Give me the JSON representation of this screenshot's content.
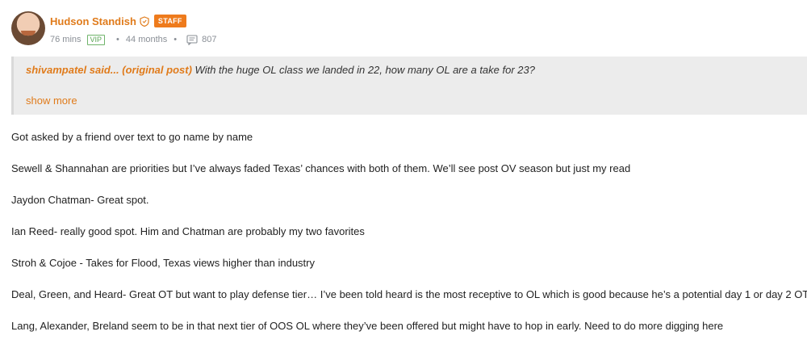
{
  "author": {
    "name": "Hudson Standish",
    "badge": "STAFF",
    "time_online": "76 mins",
    "vip_label": "VIP",
    "tenure": "44 months",
    "post_count": "807",
    "icons": {
      "shield": "shield-icon",
      "comments": "comment-icon"
    }
  },
  "quote": {
    "author": "shivampatel said...",
    "link_label": "original post",
    "text": "With the huge OL class we landed in 22, how many OL are a take for 23?",
    "show_more": "show more"
  },
  "post": {
    "paragraphs": [
      "Got asked by a friend over text to go name by name",
      "Sewell & Shannahan are priorities but I’ve always faded Texas’ chances with both of them. We’ll see post OV season but just my read",
      "Jaydon Chatman- Great spot.",
      "Ian Reed- really good spot. Him and Chatman are probably my two favorites",
      "Stroh & Cojoe - Takes for Flood, Texas views higher than industry",
      "Deal, Green, and Heard- Great OT but want to play defense tier… I’ve been told heard is the most receptive to OL which is good because he’s a potential day 1 or day 2 OT",
      "Lang, Alexander, Breland seem to be in that next tier of OOS OL where they’ve been offered but might have to hop in early. Need to do more digging here"
    ]
  },
  "colors": {
    "accent": "#e07b1b",
    "vip_green": "#5aa555",
    "quote_bg": "#ececec",
    "meta_gray": "#8a8f96"
  }
}
